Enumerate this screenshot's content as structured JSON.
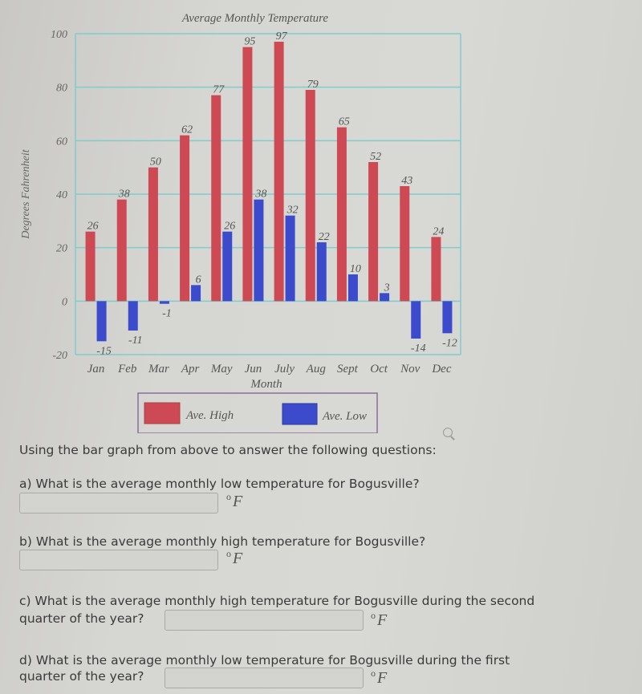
{
  "chart_data": {
    "type": "bar",
    "title": "Average Monthly Temperature",
    "xlabel": "Month",
    "ylabel": "Degrees Fahrenheit",
    "ylim": [
      -20,
      100
    ],
    "yticks": [
      100,
      80,
      60,
      40,
      20,
      0,
      -20
    ],
    "grid": true,
    "categories": [
      "Jan",
      "Feb",
      "Mar",
      "Apr",
      "May",
      "Jun",
      "July",
      "Aug",
      "Sept",
      "Oct",
      "Nov",
      "Dec"
    ],
    "series": [
      {
        "name": "Ave. High",
        "color": "#cd4a55",
        "values": [
          26,
          38,
          50,
          62,
          77,
          95,
          97,
          79,
          65,
          52,
          43,
          24
        ]
      },
      {
        "name": "Ave. Low",
        "color": "#3b4bcc",
        "values": [
          -15,
          -11,
          -1,
          6,
          26,
          38,
          32,
          22,
          10,
          3,
          -14,
          -12
        ]
      }
    ],
    "legend": {
      "placement": "bottom-center",
      "entries": [
        "Ave. High",
        "Ave. Low"
      ]
    }
  },
  "colors": {
    "grid": "#7fcccc",
    "high": "#cd4a55",
    "low": "#3b4bcc",
    "legend_border": "#8a6f9a",
    "text": "#555555"
  },
  "questions": {
    "intro": "Using the bar graph from above to answer the following questions:",
    "items": [
      {
        "label": "a) What is the average monthly low temperature for Bogusville?",
        "value": "",
        "unit": "F"
      },
      {
        "label": "b) What is the average monthly high temperature for Bogusville?",
        "value": "",
        "unit": "F"
      },
      {
        "label_line1": "c) What is the average monthly high temperature for Bogusville during the second",
        "label_line2": "quarter of the year?",
        "value": "",
        "unit": "F"
      },
      {
        "label_line1": "d) What is the average monthly low temperature for Bogusville during the first",
        "label_line2": "quarter of the year?",
        "value": "",
        "unit": "F"
      }
    ],
    "degree_symbol": "o"
  },
  "icons": {
    "zoom": "magnifier-icon"
  }
}
